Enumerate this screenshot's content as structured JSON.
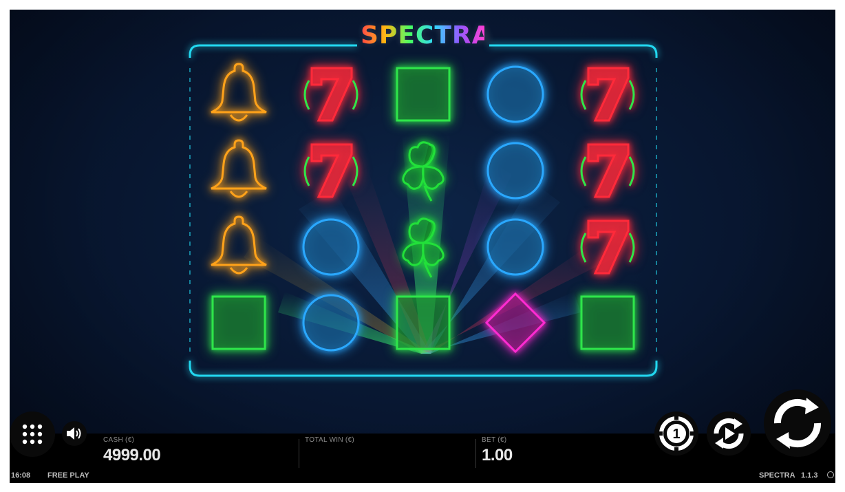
{
  "game": {
    "logo_text": "SPECTRA"
  },
  "reels": [
    [
      "bell",
      "bell",
      "bell",
      "square"
    ],
    [
      "seven",
      "seven",
      "circle",
      "circle"
    ],
    [
      "square",
      "clover",
      "clover",
      "square"
    ],
    [
      "circle",
      "circle",
      "circle",
      "diamond"
    ],
    [
      "seven",
      "seven",
      "seven",
      "square"
    ]
  ],
  "symbol_colors": {
    "bell": "#ffa21a",
    "seven": "#ff2a3a",
    "square": "#2ee64a",
    "circle": "#2aa8ff",
    "clover": "#22e03a",
    "diamond": "#ff2bd2"
  },
  "frame_color": "#22d8f0",
  "hud": {
    "cash_label": "CASH (€)",
    "cash_value": "4999.00",
    "total_win_label": "TOTAL WIN (€)",
    "total_win_value": "",
    "bet_label": "BET (€)",
    "bet_value": "1.00"
  },
  "footer": {
    "time": "16:08",
    "mode": "FREE PLAY",
    "game_name": "SPECTRA",
    "version": "1.1.3"
  },
  "buttons": {
    "menu_icon": "grid-icon",
    "sound_icon": "speaker-icon",
    "coin_value": "1",
    "autoplay_icon": "autoplay-icon",
    "spin_icon": "spin-arrows-icon"
  }
}
